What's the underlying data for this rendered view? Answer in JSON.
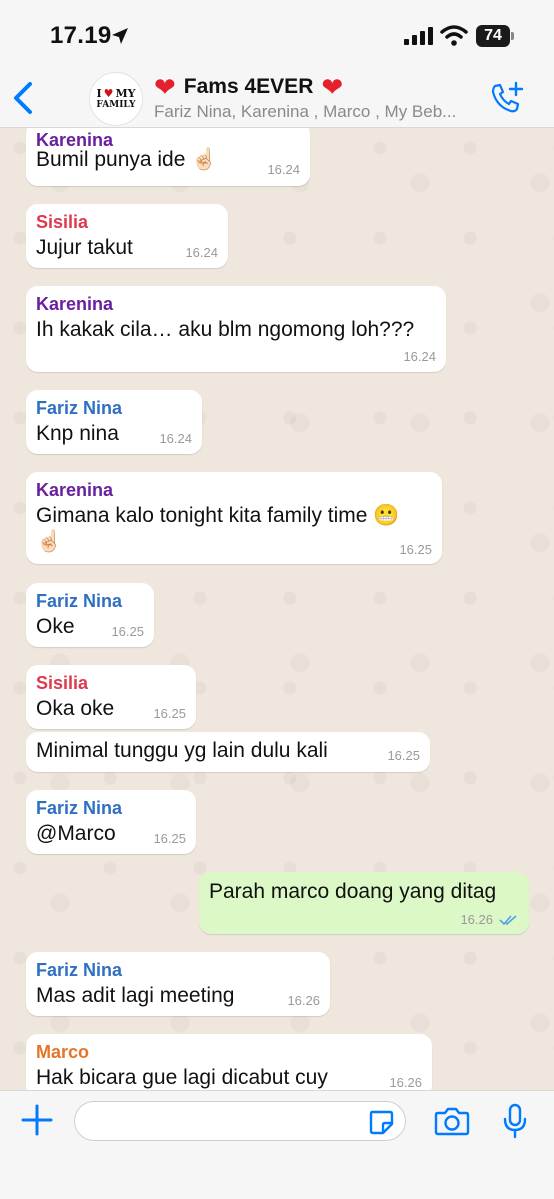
{
  "status": {
    "time": "17.19",
    "battery": "74"
  },
  "header": {
    "logo_line1_a": "I",
    "logo_line1_b": "MY",
    "logo_line2": "FAMILY",
    "title": "Fams 4EVER",
    "members": "Fariz Nina, Karenina , Marco , My Beb..."
  },
  "colors": {
    "accent": "#007aff",
    "outgoing_bubble": "#dcf8c6",
    "karenina": "#6a1f9e",
    "sisilia": "#e0394e",
    "fariz": "#2f6fc4",
    "marco": "#e5752b"
  },
  "messages": [
    {
      "sender": "Karenina",
      "text": "Bumil punya ide ☝🏻",
      "time": "16.24"
    },
    {
      "sender": "Sisilia",
      "text": "Jujur takut",
      "time": "16.24"
    },
    {
      "sender": "Karenina",
      "text": "Ih kakak cila… aku blm ngomong loh???",
      "time": "16.24"
    },
    {
      "sender": "Fariz Nina",
      "text": "Knp nina",
      "time": "16.24"
    },
    {
      "sender": "Karenina",
      "text": "Gimana kalo tonight kita family time 😬",
      "text2": "☝🏻",
      "time": "16.25"
    },
    {
      "sender": "Fariz Nina",
      "text": "Oke",
      "time": "16.25"
    },
    {
      "sender": "Sisilia",
      "text": "Oka oke",
      "time": "16.25"
    },
    {
      "sender": "",
      "text": "Minimal tunggu yg lain dulu kali",
      "time": "16.25"
    },
    {
      "sender": "Fariz Nina",
      "text": "@Marco",
      "time": "16.25"
    },
    {
      "sender": "",
      "text": "Parah marco doang yang ditag",
      "time": "16.26",
      "outgoing": true
    },
    {
      "sender": "Fariz Nina",
      "text": "Mas adit lagi meeting",
      "time": "16.26"
    },
    {
      "sender": "Marco",
      "text": "Hak bicara gue lagi dicabut cuy",
      "time": "16.26"
    }
  ],
  "input": {
    "placeholder": ""
  },
  "icons": [
    "location-arrow-icon",
    "signal-icon",
    "wifi-icon",
    "back-icon",
    "add-call-icon",
    "plus-icon",
    "sticker-icon",
    "camera-icon",
    "mic-icon",
    "read-ticks-icon"
  ]
}
